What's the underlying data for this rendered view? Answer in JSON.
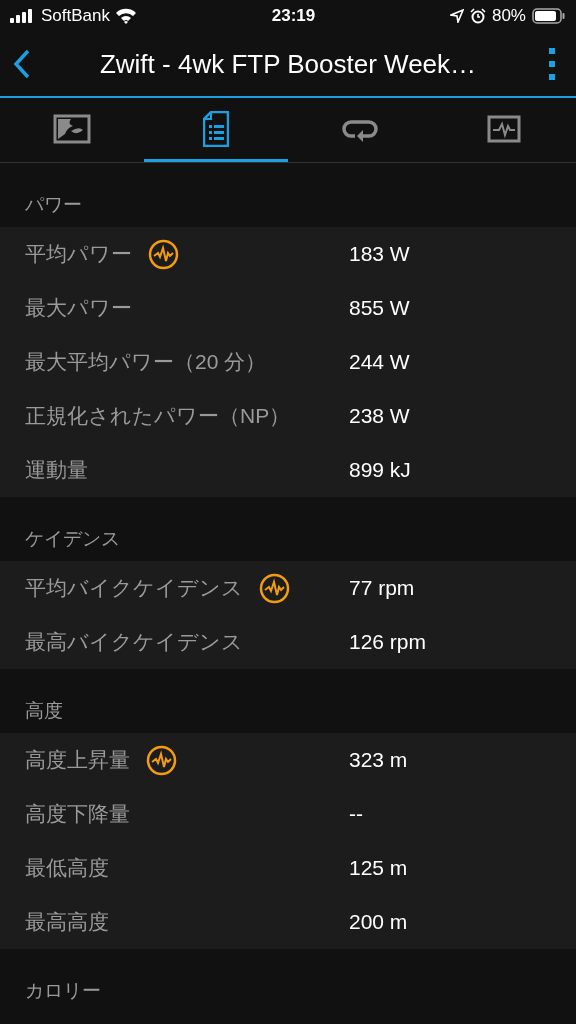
{
  "status_bar": {
    "carrier": "SoftBank",
    "time": "23:19",
    "battery": "80%"
  },
  "nav": {
    "title": "Zwift - 4wk FTP Booster Week…"
  },
  "tabs": [
    {
      "kind": "map",
      "selected": false
    },
    {
      "kind": "details",
      "selected": true
    },
    {
      "kind": "laps",
      "selected": false
    },
    {
      "kind": "chart",
      "selected": false
    }
  ],
  "sections": [
    {
      "title": "パワー",
      "rows": [
        {
          "label": "平均パワー",
          "value": "183 W",
          "badge": true
        },
        {
          "label": "最大パワー",
          "value": "855 W",
          "badge": false
        },
        {
          "label": "最大平均パワー（20 分）",
          "value": "244 W",
          "badge": false
        },
        {
          "label": "正規化されたパワー（NP）",
          "value": "238 W",
          "badge": false
        },
        {
          "label": "運動量",
          "value": "899 kJ",
          "badge": false
        }
      ]
    },
    {
      "title": "ケイデンス",
      "rows": [
        {
          "label": "平均バイクケイデンス",
          "value": "77 rpm",
          "badge": true
        },
        {
          "label": "最高バイクケイデンス",
          "value": "126 rpm",
          "badge": false
        }
      ]
    },
    {
      "title": "高度",
      "rows": [
        {
          "label": "高度上昇量",
          "value": "323 m",
          "badge": true
        },
        {
          "label": "高度下降量",
          "value": "--",
          "badge": false
        },
        {
          "label": "最低高度",
          "value": "125 m",
          "badge": false
        },
        {
          "label": "最高高度",
          "value": "200 m",
          "badge": false
        }
      ]
    },
    {
      "title": "カロリー"
    }
  ]
}
